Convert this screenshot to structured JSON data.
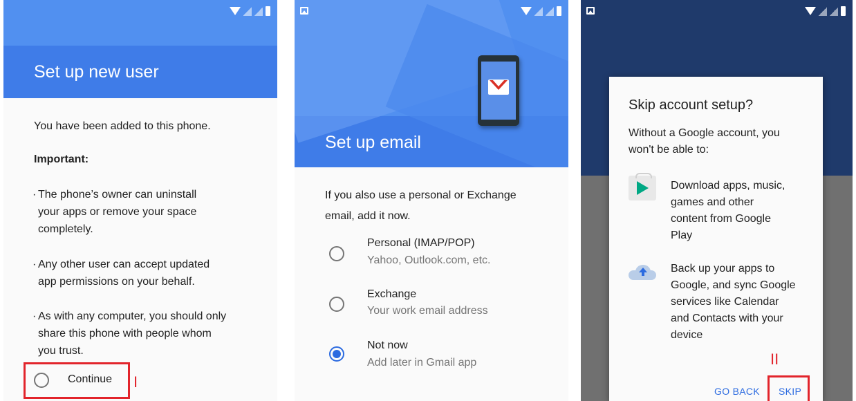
{
  "accent_color": "#3f7ce8",
  "highlight_color": "#e2242b",
  "screen1": {
    "title": "Set up new user",
    "intro": "You have been added to this phone.",
    "important_label": "Important:",
    "bullets": [
      {
        "line1": "The phone’s owner can uninstall",
        "line2": "your apps or remove your space",
        "line3": "completely."
      },
      {
        "line1": "Any other user can accept updated",
        "line2": "app permissions on your behalf.",
        "line3": ""
      },
      {
        "line1": "As with any computer, you should only",
        "line2": "share this phone with people whom",
        "line3": "you trust."
      }
    ],
    "continue_label": "Continue",
    "marker": "I"
  },
  "screen2": {
    "title": "Set up email",
    "prompt_line1": "If you also use a personal or Exchange",
    "prompt_line2": "email, add it now.",
    "options": [
      {
        "title": "Personal (IMAP/POP)",
        "subtitle": "Yahoo, Outlook.com, etc.",
        "selected": false
      },
      {
        "title": "Exchange",
        "subtitle": "Your work email address",
        "selected": false
      },
      {
        "title": "Not now",
        "subtitle": "Add later in Gmail app",
        "selected": true
      }
    ]
  },
  "screen3": {
    "dialog_title": "Skip account setup?",
    "dialog_desc_line1": "Without a Google account, you",
    "dialog_desc_line2": "won't be able to:",
    "features": [
      {
        "icon": "play-store-icon",
        "lines": [
          "Download apps, music,",
          "games and other",
          "content from Google",
          "Play"
        ]
      },
      {
        "icon": "cloud-upload-icon",
        "lines": [
          "Back up your apps to",
          "Google, and sync Google",
          "services like Calendar",
          "and Contacts with your",
          "device"
        ]
      }
    ],
    "go_back_label": "GO BACK",
    "skip_label": "SKIP",
    "marker": "II"
  }
}
